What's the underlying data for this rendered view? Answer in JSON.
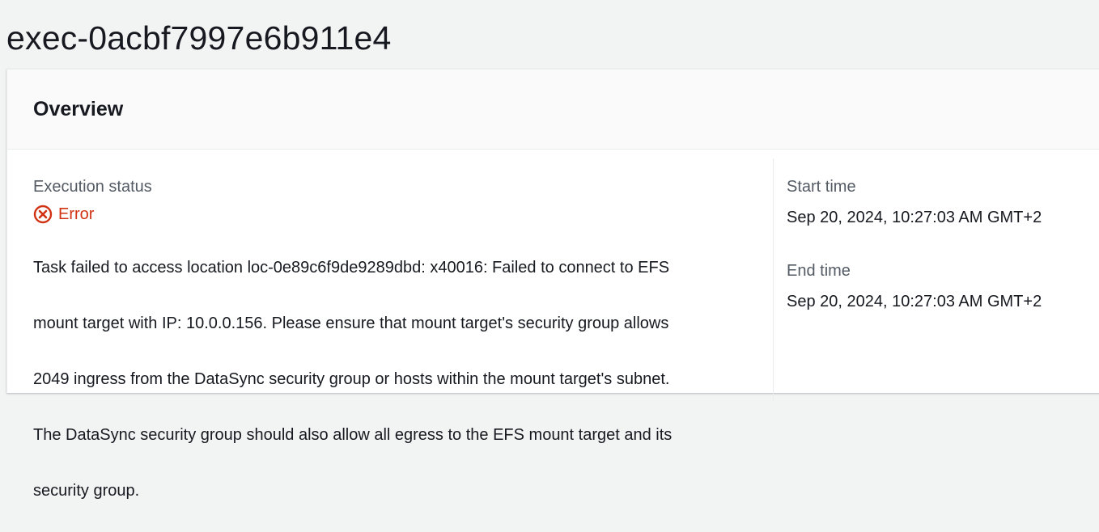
{
  "page": {
    "title": "exec-0acbf7997e6b911e4"
  },
  "overview": {
    "heading": "Overview",
    "execution_status_label": "Execution status",
    "status": {
      "text": "Error",
      "icon": "error-icon",
      "color": "#d13212"
    },
    "message_lines": [
      "Task failed to access location loc-0e89c6f9de9289dbd: x40016: Failed to connect to EFS",
      "mount target with IP: 10.0.0.156. Please ensure that mount target's security group allows",
      "2049 ingress from the DataSync security group or hosts within the mount target's subnet.",
      "The DataSync security group should also allow all egress to the EFS mount target and its",
      "security group."
    ],
    "start_time_label": "Start time",
    "start_time_value": "Sep 20, 2024, 10:27:03 AM GMT+2",
    "end_time_label": "End time",
    "end_time_value": "Sep 20, 2024, 10:27:03 AM GMT+2"
  }
}
